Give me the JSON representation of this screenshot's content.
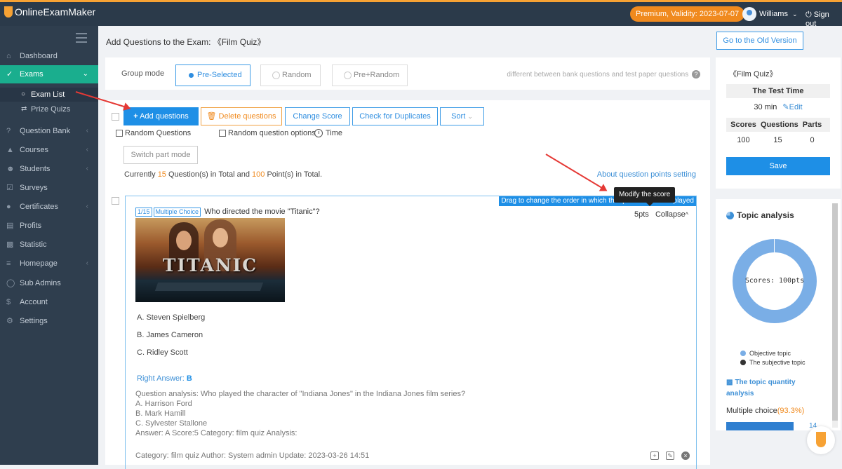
{
  "app": {
    "logo_text": "OnlineExamMaker",
    "premium": "Premium, Validity: 2023-07-07",
    "user": "Williams",
    "signout": "Sign out"
  },
  "sidebar": {
    "items": [
      {
        "label": "Dashboard",
        "icon": "home-icon"
      },
      {
        "label": "Exams",
        "icon": "check-circle-icon"
      },
      {
        "label": "Question Bank",
        "icon": "question-icon"
      },
      {
        "label": "Courses",
        "icon": "courses-icon"
      },
      {
        "label": "Students",
        "icon": "users-icon"
      },
      {
        "label": "Surveys",
        "icon": "survey-icon"
      },
      {
        "label": "Certificates",
        "icon": "certificate-icon"
      },
      {
        "label": "Profits",
        "icon": "profits-icon"
      },
      {
        "label": "Statistic",
        "icon": "statistic-icon"
      },
      {
        "label": "Homepage",
        "icon": "homepage-icon"
      },
      {
        "label": "Sub Admins",
        "icon": "admins-icon"
      },
      {
        "label": "Account",
        "icon": "dollar-icon"
      },
      {
        "label": "Settings",
        "icon": "gear-icon"
      }
    ],
    "sub": [
      {
        "label": "Exam List"
      },
      {
        "label": "Prize Quizs"
      }
    ]
  },
  "page": {
    "title": "Add Questions to the Exam: 《Film Quiz》",
    "old_version": "Go to the Old Version"
  },
  "group_mode": {
    "label": "Group mode",
    "options": [
      "Pre-Selected",
      "Random",
      "Pre+Random"
    ],
    "selected": "Pre-Selected",
    "hint": "different between bank questions and test paper questions"
  },
  "toolbar": {
    "add": "Add questions",
    "delete": "Delete questions",
    "change_score": "Change Score",
    "check_dup": "Check for Duplicates",
    "sort": "Sort"
  },
  "options": {
    "random_questions": "Random Questions",
    "random_options": "Random question options",
    "time": "Time",
    "switch_part": "Switch part mode"
  },
  "summary": {
    "prefix": "Currently ",
    "questions": "15",
    "mid": " Question(s) in Total and ",
    "points": "100",
    "suffix": " Point(s) in Total.",
    "point_setting": "About question points setting"
  },
  "question": {
    "index": "1/15",
    "type": "Multiple Choice",
    "text": "Who directed the movie \"Titanic\"?",
    "poster_text": "TITANIC",
    "points": "5pts",
    "collapse": "Collapse",
    "drag_hint": "Drag to change the order in which the questions are displayed",
    "tooltip": "Modify the score",
    "options": [
      "A. Steven Spielberg",
      "B. James Cameron",
      "C. Ridley Scott"
    ],
    "right_answer_label": "Right Answer: ",
    "right_answer": "B",
    "analysis": [
      "Question analysis: Who played the character of \"Indiana Jones\" in the Indiana Jones film series?",
      "A. Harrison Ford",
      "B. Mark Hamill",
      "C. Sylvester Stallone",
      "Answer: A Score:5 Category: film quiz Analysis:"
    ],
    "meta": "Category: film quiz   Author: System admin   Update: 2023-03-26 14:51"
  },
  "quiz_panel": {
    "title": "《Film Quiz》",
    "test_time_label": "The Test Time",
    "time": "30 min",
    "edit": "Edit",
    "headers": [
      "Scores",
      "Questions",
      "Parts"
    ],
    "values": [
      "100",
      "15",
      "0"
    ],
    "save": "Save"
  },
  "topic": {
    "title": "Topic analysis",
    "donut_label": "Scores: 100pts",
    "legend": [
      {
        "label": "Objective topic",
        "color": "#7aaee6"
      },
      {
        "label": "The subjective topic",
        "color": "#333333"
      }
    ],
    "quantity_title": "The topic quantity analysis",
    "mc_label": "Multiple choice",
    "mc_pct": "(93.3%)",
    "mc_count": "14",
    "mc_fraction": 0.933
  },
  "colors": {
    "accent": "#1e8fe6",
    "sidebar": "#2f3e4e",
    "active": "#1aae8e",
    "orange": "#f08a1e"
  }
}
